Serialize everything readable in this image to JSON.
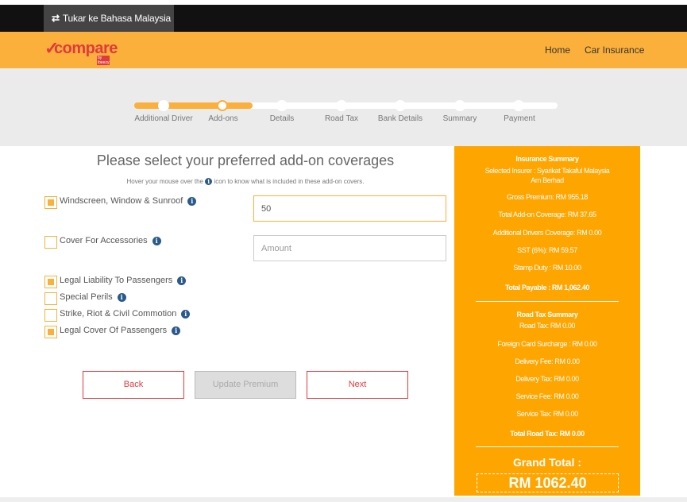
{
  "language_bar": {
    "icon": "swap-arrows-icon",
    "label": "Tukar ke Bahasa Malaysia"
  },
  "header": {
    "logo_text": "compare",
    "logo_sub": "by ibeezy",
    "nav": [
      "Home",
      "Car Insurance"
    ]
  },
  "steps": {
    "labels": [
      "Additional Driver",
      "Add-ons",
      "Details",
      "Road Tax",
      "Bank Details",
      "Summary",
      "Payment"
    ],
    "current": "Add-ons"
  },
  "main": {
    "title": "Please select your preferred add-on coverages",
    "hint_before": "Hover your mouse over the",
    "hint_after": "icon to know what is included in these add-on covers.",
    "options": [
      {
        "label": "Windscreen, Window & Sunroof",
        "checked": true
      },
      {
        "label": "Cover For Accessories",
        "checked": false
      },
      {
        "label": "Legal Liability To Passengers",
        "checked": true
      },
      {
        "label": "Special Perils",
        "checked": false
      },
      {
        "label": "Strike, Riot & Civil Commotion",
        "checked": false
      },
      {
        "label": "Legal Cover Of Passengers",
        "checked": true
      }
    ],
    "windscreen_value": "50",
    "accessories_placeholder": "Amount",
    "buttons": {
      "back": "Back",
      "update": "Update Premium",
      "next": "Next"
    }
  },
  "summary": {
    "insurance_title": "Insurance Summary",
    "insurer_line1": "Selected Insurer : Syarikat Takaful Malaysia",
    "insurer_line2": "Am Berhad",
    "gross_premium": "Gross Premium: RM 955.18",
    "total_addon": "Total Add-on Coverage: RM 37.65",
    "additional_drivers": "Additional Drivers Coverage: RM 0.00",
    "sst": "SST (6%): RM 59.57",
    "stamp_duty": "Stamp Duty : RM 10.00",
    "total_payable": "Total Payable : RM 1,062.40",
    "roadtax_title": "Road Tax Summary",
    "road_tax": "Road Tax: RM 0.00",
    "foreign_card": "Foreign Card Surcharge : RM 0.00",
    "delivery_fee": "Delivery Fee: RM 0.00",
    "delivery_tax": "Delivery Tax: RM 0.00",
    "service_fee": "Service Fee: RM 0.00",
    "service_tax": "Service Tax: RM 0.00",
    "total_road_tax": "Total Road Tax: RM 0.00",
    "grand_total_label": "Grand Total :",
    "grand_total_value": "RM 1062.40"
  },
  "colors": {
    "accent": "#fbb03b",
    "summary_bg": "#ffa500",
    "brand_red": "#e03a3e",
    "info_blue": "#2a5a8c"
  }
}
